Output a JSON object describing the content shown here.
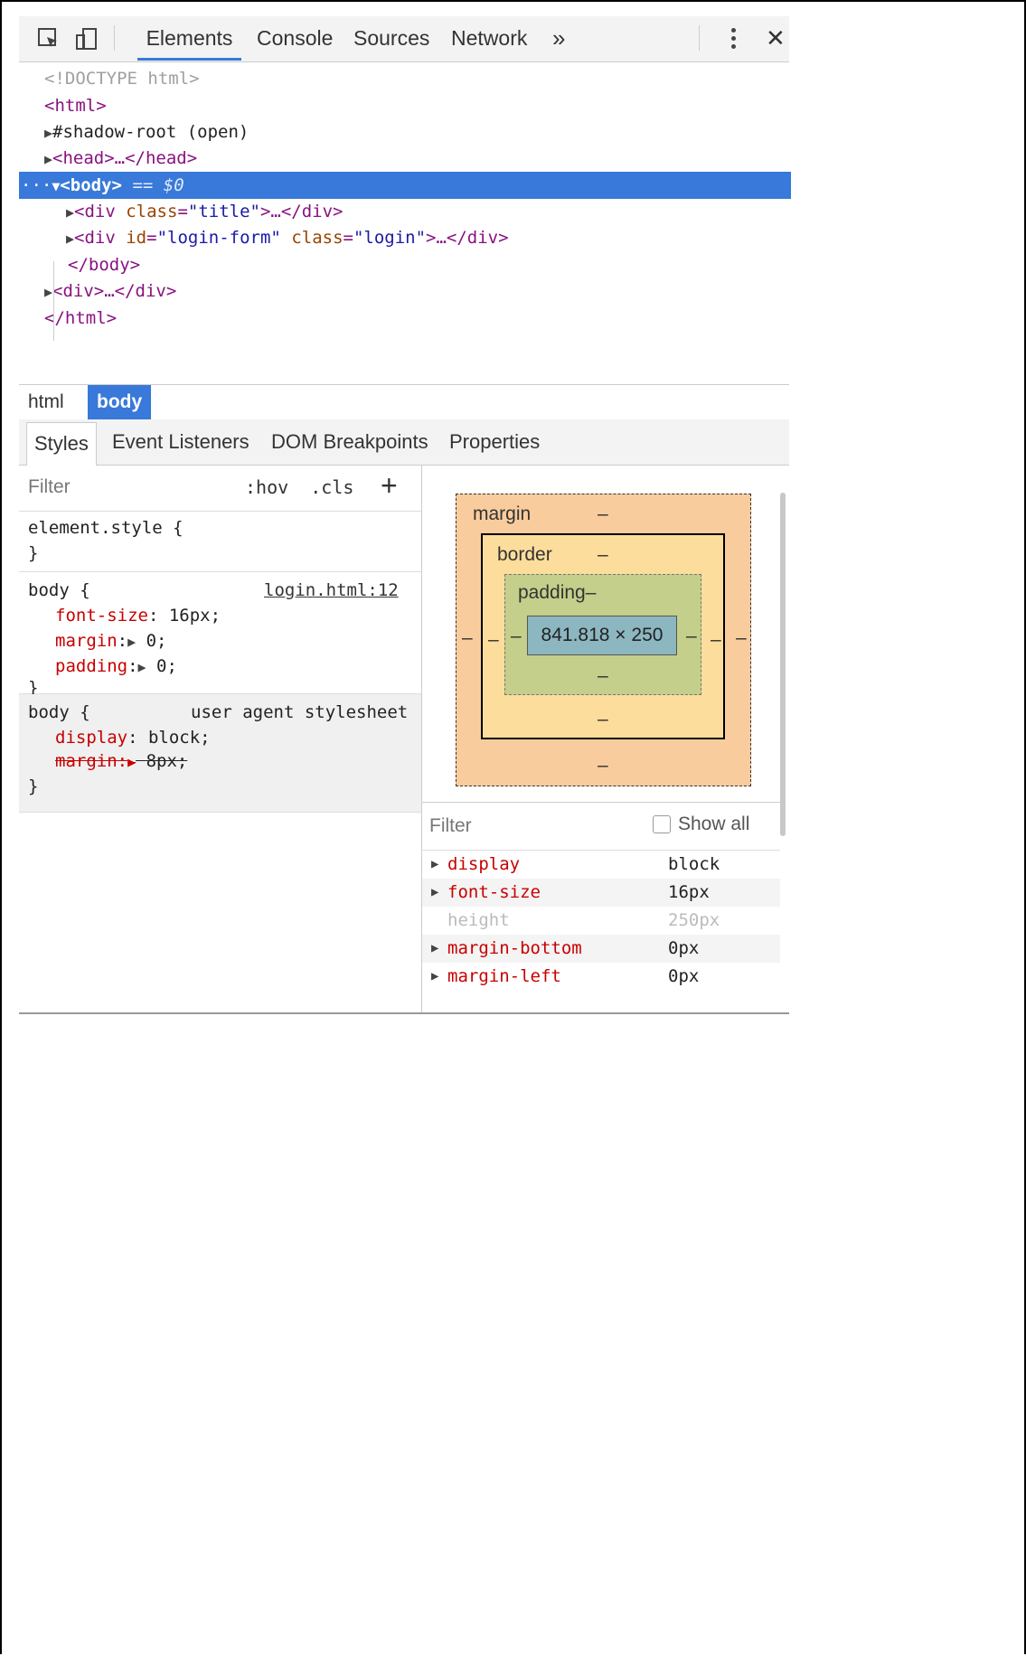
{
  "toolbar": {
    "tabs": [
      "Elements",
      "Console",
      "Sources",
      "Network"
    ],
    "more": "»",
    "close": "✕"
  },
  "dom": {
    "doctype": "<!DOCTYPE html>",
    "html_open": "<html>",
    "shadow": "#shadow-root (open)",
    "head": "<head>…</head>",
    "body_open": "<body>",
    "body_eq": " == $0",
    "div1_a": "<div ",
    "div1_attr": "class",
    "div1_val": "\"title\"",
    "div1_b": ">…</div>",
    "div2_a": "<div ",
    "div2_attr1": "id",
    "div2_val1": "\"login-form\"",
    "div2_attr2": "class",
    "div2_val2": "\"login\"",
    "div2_b": ">…</div>",
    "body_close": "</body>",
    "div3": "<div>…</div>",
    "html_close": "</html>",
    "dots": "···"
  },
  "breadcrumb": [
    "html",
    "body"
  ],
  "subtabs": [
    "Styles",
    "Event Listeners",
    "DOM Breakpoints",
    "Properties"
  ],
  "styles": {
    "filter_placeholder": "Filter",
    "hov": ":hov",
    "cls": ".cls",
    "add": "+",
    "element_style": "element.style {",
    "close_brace": "}",
    "rule1_selector": "body {",
    "rule1_source": "login.html:12",
    "rule1_props": [
      {
        "name": "font-size",
        "value": "16px;"
      },
      {
        "name": "margin",
        "value": "0;"
      },
      {
        "name": "padding",
        "value": "0;"
      }
    ],
    "rule2_selector": "body {",
    "rule2_source": "user agent stylesheet",
    "rule2_prop1_name": "display",
    "rule2_prop1_value": "block;",
    "rule2_prop2_name": "margin:",
    "rule2_prop2_value": "8px;"
  },
  "box_model": {
    "margin_label": "margin",
    "border_label": "border",
    "padding_label": "padding",
    "dash": "–",
    "content": "841.818 × 250"
  },
  "computed": {
    "filter_placeholder": "Filter",
    "show_all": "Show all",
    "rows": [
      {
        "name": "display",
        "value": "block"
      },
      {
        "name": "font-size",
        "value": "16px"
      },
      {
        "name": "height",
        "value": "250px"
      },
      {
        "name": "margin-bottom",
        "value": "0px"
      },
      {
        "name": "margin-left",
        "value": "0px"
      }
    ]
  },
  "colors": {
    "accent": "#3879d9",
    "margin": "#f9cc9d",
    "border": "#fddd9b",
    "padding": "#c3cf8a",
    "content": "#8cb6c0"
  }
}
